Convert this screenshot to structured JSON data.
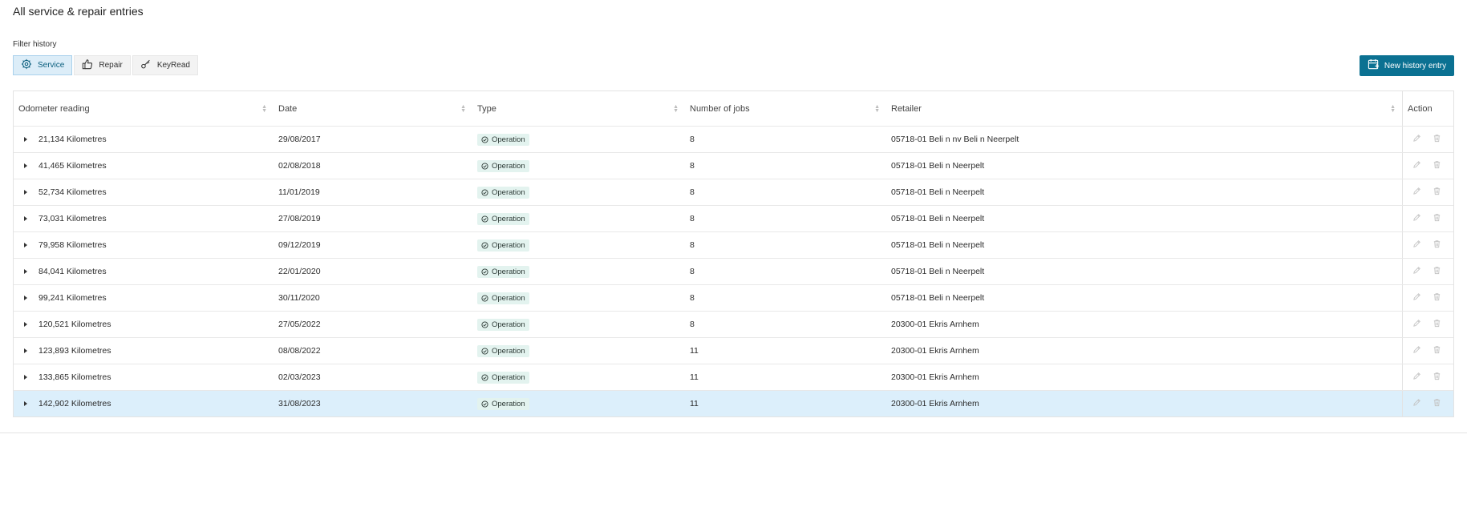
{
  "page": {
    "title": "All service & repair entries"
  },
  "filter": {
    "label": "Filter history",
    "buttons": [
      {
        "label": "Service",
        "icon": "service-gear-icon",
        "active": true
      },
      {
        "label": "Repair",
        "icon": "thumbs-up-icon",
        "active": false
      },
      {
        "label": "KeyRead",
        "icon": "key-icon",
        "active": false
      }
    ]
  },
  "actions": {
    "new_entry_label": "New history entry",
    "new_entry_icon": "calendar-plus-icon"
  },
  "table": {
    "columns": [
      "Odometer reading",
      "Date",
      "Type",
      "Number of jobs",
      "Retailer",
      "Action"
    ],
    "rows": [
      {
        "odometer": "21,134 Kilometres",
        "date": "29/08/2017",
        "type": "Operation",
        "jobs": "8",
        "retailer": "05718-01 Beli n nv Beli n Neerpelt"
      },
      {
        "odometer": "41,465 Kilometres",
        "date": "02/08/2018",
        "type": "Operation",
        "jobs": "8",
        "retailer": "05718-01 Beli n Neerpelt"
      },
      {
        "odometer": "52,734 Kilometres",
        "date": "11/01/2019",
        "type": "Operation",
        "jobs": "8",
        "retailer": "05718-01 Beli n Neerpelt"
      },
      {
        "odometer": "73,031 Kilometres",
        "date": "27/08/2019",
        "type": "Operation",
        "jobs": "8",
        "retailer": "05718-01 Beli n Neerpelt"
      },
      {
        "odometer": "79,958 Kilometres",
        "date": "09/12/2019",
        "type": "Operation",
        "jobs": "8",
        "retailer": "05718-01 Beli n Neerpelt"
      },
      {
        "odometer": "84,041 Kilometres",
        "date": "22/01/2020",
        "type": "Operation",
        "jobs": "8",
        "retailer": "05718-01 Beli n Neerpelt"
      },
      {
        "odometer": "99,241 Kilometres",
        "date": "30/11/2020",
        "type": "Operation",
        "jobs": "8",
        "retailer": "05718-01 Beli n Neerpelt"
      },
      {
        "odometer": "120,521 Kilometres",
        "date": "27/05/2022",
        "type": "Operation",
        "jobs": "8",
        "retailer": "20300-01 Ekris Arnhem"
      },
      {
        "odometer": "123,893 Kilometres",
        "date": "08/08/2022",
        "type": "Operation",
        "jobs": "11",
        "retailer": "20300-01 Ekris Arnhem"
      },
      {
        "odometer": "133,865 Kilometres",
        "date": "02/03/2023",
        "type": "Operation",
        "jobs": "11",
        "retailer": "20300-01 Ekris Arnhem"
      },
      {
        "odometer": "142,902 Kilometres",
        "date": "31/08/2023",
        "type": "Operation",
        "jobs": "11",
        "retailer": "20300-01 Ekris Arnhem",
        "selected": true
      }
    ]
  },
  "colors": {
    "accent": "#0b7192",
    "selected_row": "#dceffb",
    "active_filter": "#dcedf8",
    "badge_bg": "#e3f3ef"
  }
}
